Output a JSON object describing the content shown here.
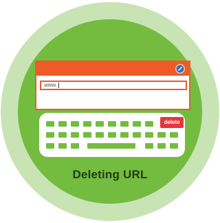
{
  "illustration": {
    "address_bar": {
      "value": "www."
    },
    "keyboard": {
      "delete_label": "delete"
    },
    "caption": "Deleting URL",
    "icons": {
      "browser": "globe-icon"
    },
    "colors": {
      "outer_ring": "#c8e4b4",
      "inner_circle": "#74bc40",
      "browser_accent": "#f05a28",
      "delete_key": "#e8353a",
      "caption_text": "#1e3d10"
    }
  }
}
